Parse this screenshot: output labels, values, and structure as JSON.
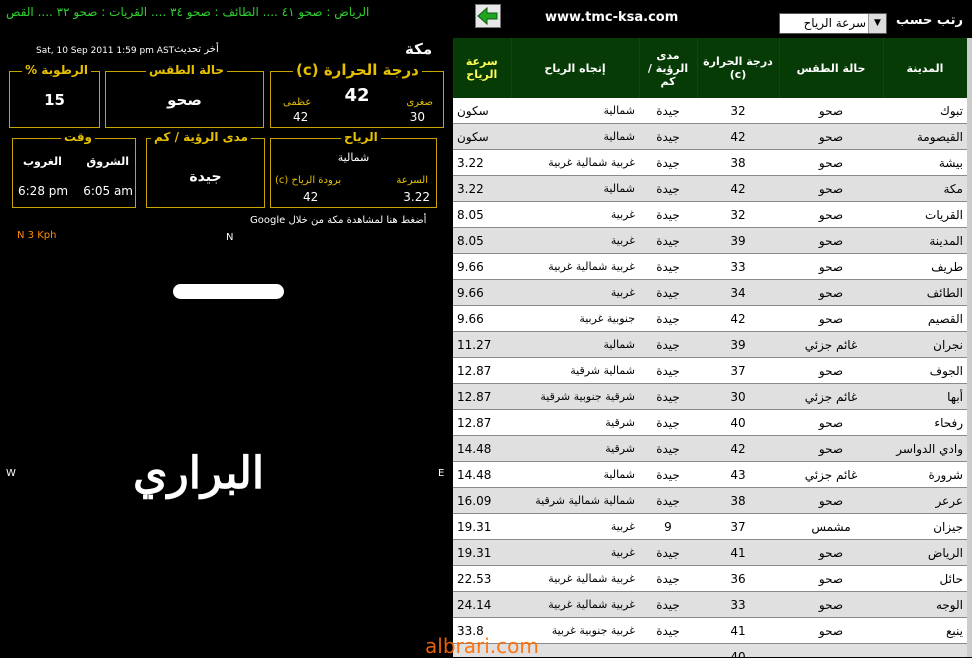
{
  "top": {
    "ticker": "الرياض : صحو ٤١  ....  الطائف : صحو ٣٤  ....  القريات : صحو ٣٢  ....  القص",
    "url": "www.tmc-ksa.com",
    "sort_label": "رتب حسب",
    "sort_value": "سرعة الرياح",
    "back_icon": "green-left-arrow"
  },
  "panel": {
    "city": "مكة",
    "updated_label": "أخر تحديث",
    "updated_value": "Sat, 10 Sep 2011 1:59 pm AST",
    "humidity": {
      "title": "% الرطوبة",
      "value": "15"
    },
    "condition": {
      "title": "حالة الطقس",
      "value": "صحو"
    },
    "temperature": {
      "title": "(c) درجة الحرارة",
      "current": "42",
      "min_label": "صغرى",
      "min": "30",
      "max_label": "عظمى",
      "max": "42"
    },
    "time": {
      "title": "وقت",
      "sunrise_label": "الشروق",
      "sunrise": "6:05 am",
      "sunset_label": "الغروب",
      "sunset": "6:28 pm"
    },
    "visibility": {
      "title": "مدى الرؤية / كم",
      "value": "جيدة"
    },
    "wind": {
      "title": "الرياح",
      "direction": "شمالية",
      "speed_label": "السرعة",
      "speed": "3.22",
      "chill_label": "(c) برودة الرياح",
      "chill": "42"
    },
    "google_text": "Google أضغط هنا لمشاهدة مكة من خلال",
    "map_speed": "N  3 Kph",
    "compass_n": "N",
    "compass_w": "W",
    "compass_e": "E",
    "logo": "البراري",
    "watermark": "albrari.com"
  },
  "table": {
    "headers": {
      "city": "المدينة",
      "condition": "حالة الطقس",
      "temp": "درجة الحرارة (c)",
      "visibility": "مدى الرؤية / كم",
      "direction": "إتجاه الرياح",
      "speed": "سرعة الرياح"
    },
    "rows": [
      {
        "city": "تبوك",
        "cond": "صحو",
        "temp": "32",
        "vis": "جيدة",
        "dir": "شمالية",
        "spd": "سكون"
      },
      {
        "city": "القيصومة",
        "cond": "صحو",
        "temp": "42",
        "vis": "جيدة",
        "dir": "شمالية",
        "spd": "سكون"
      },
      {
        "city": "بيشة",
        "cond": "صحو",
        "temp": "38",
        "vis": "جيدة",
        "dir": "غربية شمالية غربية",
        "spd": "3.22"
      },
      {
        "city": "مكة",
        "cond": "صحو",
        "temp": "42",
        "vis": "جيدة",
        "dir": "شمالية",
        "spd": "3.22"
      },
      {
        "city": "القريات",
        "cond": "صحو",
        "temp": "32",
        "vis": "جيدة",
        "dir": "غربية",
        "spd": "8.05"
      },
      {
        "city": "المدينة",
        "cond": "صحو",
        "temp": "39",
        "vis": "جيدة",
        "dir": "غربية",
        "spd": "8.05"
      },
      {
        "city": "طريف",
        "cond": "صحو",
        "temp": "33",
        "vis": "جيدة",
        "dir": "غربية شمالية غربية",
        "spd": "9.66"
      },
      {
        "city": "الطائف",
        "cond": "صحو",
        "temp": "34",
        "vis": "جيدة",
        "dir": "غربية",
        "spd": "9.66"
      },
      {
        "city": "القصيم",
        "cond": "صحو",
        "temp": "42",
        "vis": "جيدة",
        "dir": "جنوبية غربية",
        "spd": "9.66"
      },
      {
        "city": "نجران",
        "cond": "غائم جزئي",
        "temp": "39",
        "vis": "جيدة",
        "dir": "شمالية",
        "spd": "11.27"
      },
      {
        "city": "الجوف",
        "cond": "صحو",
        "temp": "37",
        "vis": "جيدة",
        "dir": "شمالية شرقية",
        "spd": "12.87"
      },
      {
        "city": "أبها",
        "cond": "غائم جزئي",
        "temp": "30",
        "vis": "جيدة",
        "dir": "شرقية جنوبية شرقية",
        "spd": "12.87"
      },
      {
        "city": "رفحاء",
        "cond": "صحو",
        "temp": "40",
        "vis": "جيدة",
        "dir": "شرقية",
        "spd": "12.87"
      },
      {
        "city": "وادي الدواسر",
        "cond": "صحو",
        "temp": "42",
        "vis": "جيدة",
        "dir": "شرقية",
        "spd": "14.48"
      },
      {
        "city": "شرورة",
        "cond": "غائم جزئي",
        "temp": "43",
        "vis": "جيدة",
        "dir": "شمالية",
        "spd": "14.48"
      },
      {
        "city": "عرعر",
        "cond": "صحو",
        "temp": "38",
        "vis": "جيدة",
        "dir": "شمالية شمالية شرقية",
        "spd": "16.09"
      },
      {
        "city": "جيزان",
        "cond": "مشمس",
        "temp": "37",
        "vis": "9",
        "dir": "غربية",
        "spd": "19.31"
      },
      {
        "city": "الرياض",
        "cond": "صحو",
        "temp": "41",
        "vis": "جيدة",
        "dir": "غربية",
        "spd": "19.31"
      },
      {
        "city": "حائل",
        "cond": "صحو",
        "temp": "36",
        "vis": "جيدة",
        "dir": "غربية شمالية غربية",
        "spd": "22.53"
      },
      {
        "city": "الوجه",
        "cond": "صحو",
        "temp": "33",
        "vis": "جيدة",
        "dir": "غربية شمالية غربية",
        "spd": "24.14"
      },
      {
        "city": "ينبع",
        "cond": "صحو",
        "temp": "41",
        "vis": "جيدة",
        "dir": "غربية جنوبية غربية",
        "spd": "33.8"
      },
      {
        "city": "",
        "cond": "",
        "temp": "40",
        "vis": "",
        "dir": "",
        "spd": ""
      }
    ]
  }
}
